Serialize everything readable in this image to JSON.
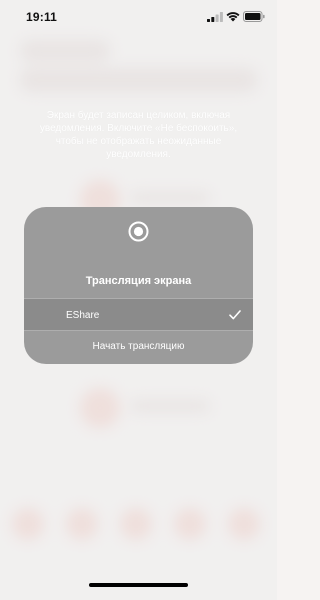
{
  "status_bar": {
    "time": "19:11"
  },
  "notice": {
    "text": "Экран будет записан целиком, включая уведомления. Включите «Не беспокоить», чтобы не отображать неожиданные уведомления."
  },
  "broadcast_panel": {
    "title": "Трансляция экрана",
    "selected_device": "EShare",
    "start_label": "Начать трансляцию"
  },
  "icons": [
    "signal-icon",
    "wifi-icon",
    "battery-icon",
    "record-icon",
    "checkmark-icon"
  ],
  "colors": {
    "panel": "#9b9b9b",
    "selected_row": "#8b8b8b",
    "text": "#ffffff"
  }
}
